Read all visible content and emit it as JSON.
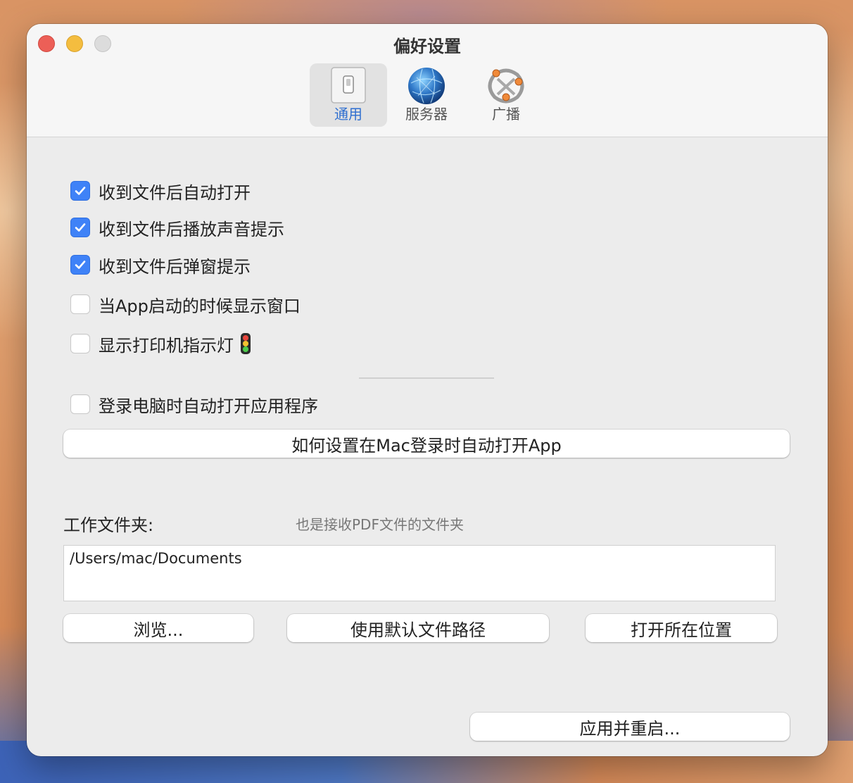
{
  "window": {
    "title": "偏好设置",
    "controls": [
      "close",
      "minimize",
      "zoom"
    ]
  },
  "tabs": [
    {
      "label": "通用",
      "icon": "switch-icon",
      "active": true
    },
    {
      "label": "服务器",
      "icon": "network-globe-icon",
      "active": false
    },
    {
      "label": "广播",
      "icon": "bonjour-broadcast-icon",
      "active": false
    }
  ],
  "options": [
    {
      "label": "收到文件后自动打开",
      "checked": true
    },
    {
      "label": "收到文件后播放声音提示",
      "checked": true
    },
    {
      "label": "收到文件后弹窗提示",
      "checked": true
    },
    {
      "label": "当App启动的时候显示窗口",
      "checked": false
    },
    {
      "label": "显示打印机指示灯",
      "checked": false,
      "icon": "traffic-light-icon"
    }
  ],
  "login_option": {
    "label": "登录电脑时自动打开应用程序",
    "checked": false
  },
  "login_help_button": "如何设置在Mac登录时自动打开App",
  "work_folder": {
    "label": "工作文件夹:",
    "hint": "也是接收PDF文件的文件夹",
    "path": "/Users/mac/Documents"
  },
  "folder_buttons": {
    "browse": "浏览...",
    "use_default": "使用默认文件路径",
    "open_location": "打开所在位置"
  },
  "apply_button": "应用并重启...",
  "colors": {
    "accent": "#3f82f7",
    "active_tab_text": "#2f6fd0"
  }
}
